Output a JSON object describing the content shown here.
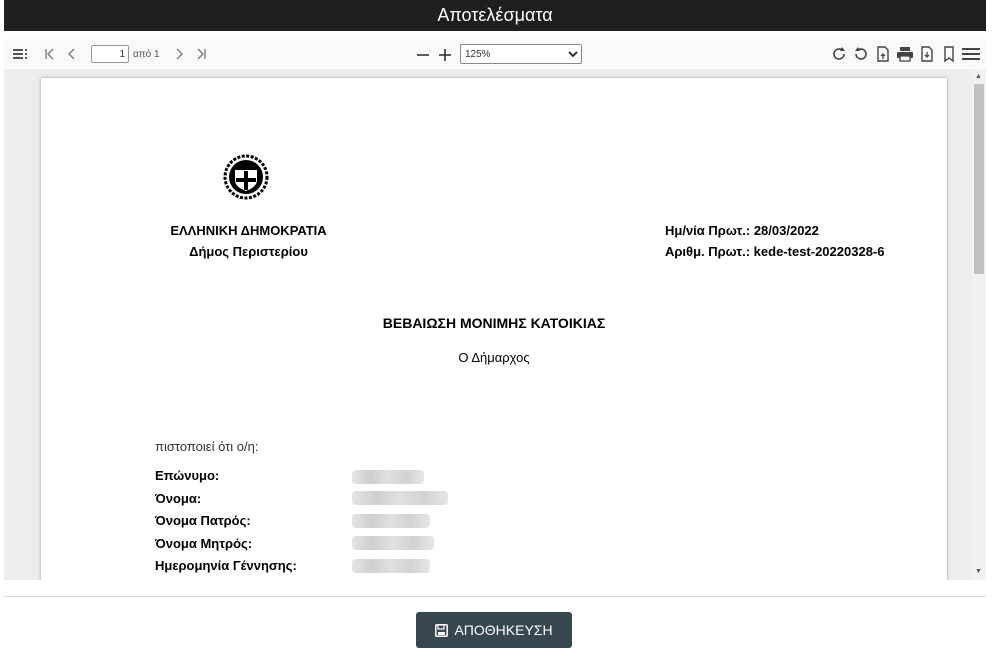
{
  "window": {
    "title": "Αποτελέσματα"
  },
  "toolbar": {
    "page_number": "1",
    "page_of": "από 1",
    "zoom": "125%",
    "zoom_options": [
      "125%"
    ]
  },
  "document": {
    "org_line1": "ΕΛΛΗΝΙΚΗ ΔΗΜΟΚΡΑΤΙΑ",
    "org_line2": "Δήμος Περιστερίου",
    "protocol_date_label": "Ημ/νία Πρωτ.:",
    "protocol_date": "28/03/2022",
    "protocol_number_label": "Αριθμ. Πρωτ.:",
    "protocol_number": "kede-test-20220328-6",
    "title": "ΒΕΒΑΙΩΣΗ ΜΟΝΙΜΗΣ ΚΑΤΟΙΚΙΑΣ",
    "subtitle": "Ο Δήμαρχος",
    "certify_text": "πιστοποιεί ότι ο/η:",
    "fields": [
      {
        "label": "Επώνυμο:"
      },
      {
        "label": "Όνομα:"
      },
      {
        "label": "Όνομα Πατρός:"
      },
      {
        "label": "Όνομα Μητρός:"
      },
      {
        "label": "Ημερομηνία Γέννησης:"
      }
    ]
  },
  "footer": {
    "save_label": "ΑΠΟΘΗΚΕΥΣΗ"
  },
  "colors": {
    "titlebar": "#1d1f21",
    "save_button": "#37474f",
    "viewer_bg": "#ededf0"
  }
}
